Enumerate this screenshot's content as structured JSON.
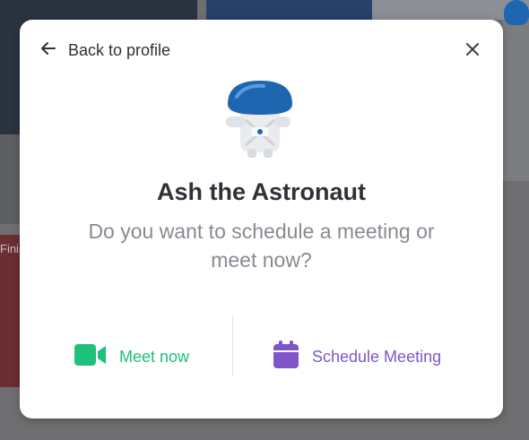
{
  "background": {
    "partial_text": "Finis"
  },
  "modal": {
    "back_label": "Back to profile",
    "name": "Ash the Astronaut",
    "question": "Do you want to schedule a meeting or meet now?",
    "actions": {
      "meet_now_label": "Meet now",
      "schedule_label": "Schedule Meeting"
    }
  },
  "icons": {
    "back": "arrow-left-icon",
    "close": "close-icon",
    "meet_now": "video-camera-icon",
    "schedule": "calendar-icon"
  },
  "colors": {
    "meet_now": "#1fc07a",
    "schedule": "#7f56c9",
    "title": "#2d3238",
    "subtitle": "#878b91",
    "avatar_helmet": "#1f66b0"
  }
}
